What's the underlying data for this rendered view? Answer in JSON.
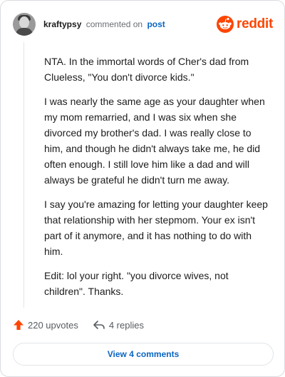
{
  "header": {
    "username": "kraftypsy",
    "commented_text": "commented on",
    "post_link": "post",
    "logo_text": "reddit",
    "brand_color": "#ff4500"
  },
  "comment": {
    "paragraphs": [
      "NTA. In the immortal words of Cher's dad from Clueless, \"You don't divorce kids.\"",
      "I was nearly the same age as your daughter when my mom remarried, and I was six when she divorced my brother's dad. I was really close to him, and though he didn't always take me, he did often enough. I still love him like a dad and will always be grateful he didn't turn me away.",
      "I say you're amazing for letting your daughter keep that relationship with her stepmom. Your ex isn't part of it anymore, and it has nothing to do with him.",
      "Edit: lol your right. \"you divorce wives, not children\". Thanks."
    ]
  },
  "actions": {
    "upvotes": "220 upvotes",
    "replies": "4 replies",
    "upvote_icon": "upvote-arrow-icon",
    "reply_icon": "reply-arrow-icon"
  },
  "footer": {
    "view_comments": "View 4 comments",
    "link_color": "#0a66c2"
  }
}
